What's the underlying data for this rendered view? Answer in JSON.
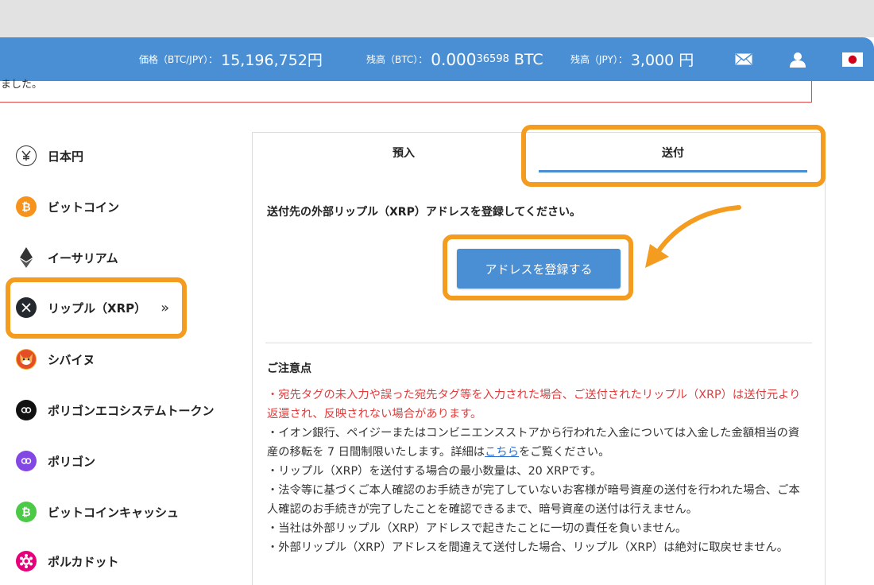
{
  "header": {
    "price_label": "価格（BTC/JPY）：",
    "price_value": "15,196,752円",
    "btc_label": "残高（BTC）：",
    "btc_value_main": "0.000",
    "btc_value_small": "36598",
    "btc_unit": "BTC",
    "jpy_label": "残高（JPY）：",
    "jpy_value": "3,000 円"
  },
  "alert": {
    "text": "ました。"
  },
  "sidebar": {
    "items": [
      {
        "label": "日本円",
        "icon": "yen-icon"
      },
      {
        "label": "ビットコイン",
        "icon": "bitcoin-icon",
        "color": "#f7931a"
      },
      {
        "label": "イーサリアム",
        "icon": "ethereum-icon"
      },
      {
        "label": "リップル（XRP）",
        "icon": "xrp-icon",
        "color": "#23292f",
        "chevron": "»"
      },
      {
        "label": "シバイヌ",
        "icon": "shiba-icon",
        "color": "#e44d26"
      },
      {
        "label": "ポリゴンエコシステムトークン",
        "icon": "pol-icon",
        "color": "#111111"
      },
      {
        "label": "ポリゴン",
        "icon": "polygon-icon",
        "color": "#8247e5"
      },
      {
        "label": "ビットコインキャッシュ",
        "icon": "bch-icon",
        "color": "#4cc947"
      },
      {
        "label": "ポルカドット",
        "icon": "polkadot-icon",
        "color": "#e6007a"
      }
    ]
  },
  "tabs": {
    "deposit": "預入",
    "send": "送付"
  },
  "main": {
    "instruction": "送付先の外部リップル（XRP）アドレスを登録してください。",
    "register_button": "アドレスを登録する",
    "notes_title": "ご注意点",
    "note1": "・宛先タグの未入力や誤った宛先タグ等を入力された場合、ご送付されたリップル（XRP）は送付元より返還され、反映されない場合があります。",
    "note2_a": "・イオン銀行、ペイジーまたはコンビニエンスストアから行われた入金については入金した金額相当の資産の移転を 7 日間制限いたします。詳細は",
    "note2_link": "こちら",
    "note2_b": "をご覧ください。",
    "note3": "・リップル（XRP）を送付する場合の最小数量は、20 XRPです。",
    "note4": "・法令等に基づくご本人確認のお手続きが完了していないお客様が暗号資産の送付を行われた場合、ご本人確認のお手続きが完了したことを確認できるまで、暗号資産の送付は行えません。",
    "note5": "・当社は外部リップル（XRP）アドレスで起きたことに一切の責任を負いません。",
    "note6": "・外部リップル（XRP）アドレスを間違えて送付した場合、リップル（XRP）は絶対に取戻せません。"
  },
  "colors": {
    "header": "#4a8fd4",
    "highlight": "#f39c1f",
    "warning": "#e03c3c"
  }
}
